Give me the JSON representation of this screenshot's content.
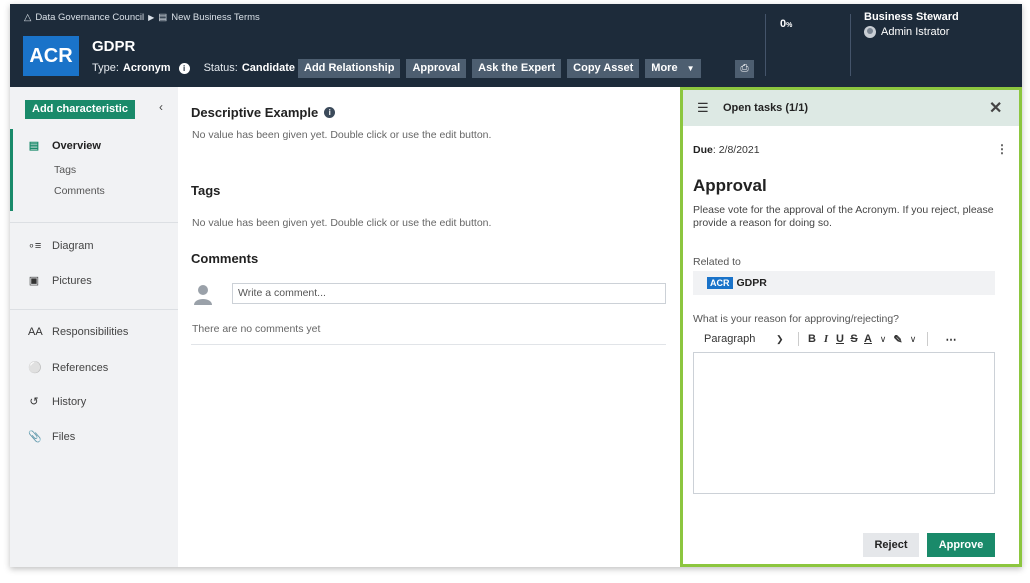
{
  "breadcrumb": {
    "community": "Data Governance Council",
    "domain": "New Business Terms",
    "community_icon": "community-icon",
    "domain_icon": "glossary-icon"
  },
  "asset": {
    "type_badge": "ACR",
    "name": "GDPR",
    "type_label": "Type:",
    "type_value": "Acronym",
    "status_label": "Status:",
    "status_value": "Candidate"
  },
  "header_buttons": {
    "add_relationship": "Add Relationship",
    "approval": "Approval",
    "ask_expert": "Ask the Expert",
    "copy_asset": "Copy Asset",
    "more": "More"
  },
  "header_right": {
    "percent": "0",
    "percent_sign": "%",
    "role": "Business Steward",
    "user": "Admin Istrator"
  },
  "sidebar": {
    "add_characteristic": "Add characteristic",
    "overview": "Overview",
    "tags": "Tags",
    "comments": "Comments",
    "diagram": "Diagram",
    "pictures": "Pictures",
    "responsibilities": "Responsibilities",
    "references": "References",
    "history": "History",
    "files": "Files"
  },
  "main": {
    "descriptive_example_title": "Descriptive Example",
    "descriptive_example_empty": "No value has been given yet. Double click or use the edit button.",
    "tags_title": "Tags",
    "tags_empty": "No value has been given yet. Double click or use the edit button.",
    "comments_title": "Comments",
    "comment_placeholder": "Write a comment...",
    "no_comments": "There are no comments yet"
  },
  "task_panel": {
    "title": "Open tasks (1/1)",
    "due_label": "Due",
    "due_value": "2/8/2021",
    "task_title": "Approval",
    "description": "Please vote for the approval of the Acronym. If you reject, please provide a reason for doing so.",
    "related_label": "Related to",
    "related_badge": "ACR",
    "related_name": "GDPR",
    "reason_label": "What is your reason for approving/rejecting?",
    "paragraph_style": "Paragraph",
    "reject": "Reject",
    "approve": "Approve"
  },
  "colors": {
    "header_bg": "#1d2b3a",
    "accent_green": "#1a8a6a",
    "acr_blue": "#1a73c9",
    "panel_border": "#8cc63f"
  }
}
